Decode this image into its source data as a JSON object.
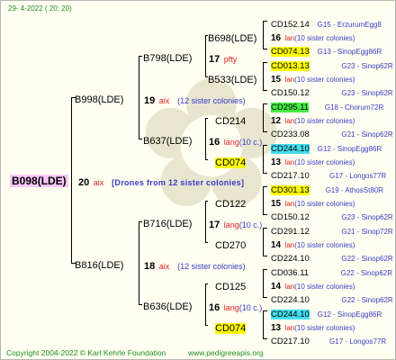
{
  "header": {
    "date": "29-  4-2022  ( 20:  20)"
  },
  "footer": {
    "copyright": "Copyright 2004-2022 © Karl Kehrle Foundation",
    "site": "www.pedigreeapis.org"
  },
  "root": {
    "label": "B098(LDE)",
    "count": "20",
    "aix": "aix",
    "note": "[Drones from 12 sister colonies]"
  },
  "gen1": [
    {
      "label": "B998(LDE)",
      "count": "19",
      "aix": "aix",
      "note": "(12 sister colonies)"
    },
    {
      "label": "B816(LDE)",
      "count": "18",
      "aix": "aix",
      "note": "(12 sister colonies)"
    }
  ],
  "gen2": [
    {
      "label": "B798(LDE)",
      "count": "17",
      "lang": "pfty",
      "paren": ""
    },
    {
      "label": "B637(LDE)",
      "count": "16",
      "lang": "lang",
      "paren": "(10 c.)"
    },
    {
      "label": "B716(LDE)",
      "count": "17",
      "lang": "lang",
      "paren": "(10 c.)"
    },
    {
      "label": "B636(LDE)",
      "count": "16",
      "lang": "lang",
      "paren": "(10 c.)"
    }
  ],
  "gen3": [
    {
      "label": "B698(LDE)",
      "count": "17",
      "lang": "pfty",
      "paren": ""
    },
    {
      "label": "B533(LDE)",
      "count": "",
      "lang": "",
      "paren": ""
    },
    {
      "label": "CD214",
      "count": "",
      "lang": "",
      "paren": ""
    },
    {
      "label": "CD074",
      "count": "",
      "lang": "",
      "paren": ""
    },
    {
      "label": "CD122",
      "count": "",
      "lang": "",
      "paren": ""
    },
    {
      "label": "CD270",
      "count": "",
      "lang": "",
      "paren": ""
    },
    {
      "label": "CD125",
      "count": "",
      "lang": "",
      "paren": ""
    },
    {
      "label": "CD074",
      "count": "",
      "lang": "",
      "paren": ""
    }
  ],
  "leaves": [
    {
      "kind": "id",
      "id": "CD152.14",
      "info": "G15 - ErzurumEgg8"
    },
    {
      "kind": "cnt",
      "num": "16",
      "lan": "lan",
      "rest": "(10 sister colonies)"
    },
    {
      "kind": "id",
      "id": "CD074.13",
      "info": "G13 - SinopEgg86R"
    },
    {
      "kind": "id",
      "id": "CD013.13",
      "info": "G23 - Sinop62R"
    },
    {
      "kind": "cnt",
      "num": "15",
      "lan": "lan",
      "rest": "(10 sister colonies)"
    },
    {
      "kind": "id",
      "id": "CD150.12",
      "info": "G23 - Sinop62R"
    },
    {
      "kind": "id",
      "id": "CD295.11",
      "info": "G18 - Chorum72R"
    },
    {
      "kind": "cnt",
      "num": "12",
      "lan": "lan",
      "rest": "(10 sister colonies)"
    },
    {
      "kind": "id",
      "id": "CD233.08",
      "info": "G21 - Sinop62R"
    },
    {
      "kind": "id",
      "id": "CD244.10",
      "info": "G12 - SinopEgg86R"
    },
    {
      "kind": "cnt",
      "num": "13",
      "lan": "lan",
      "rest": "(10 sister colonies)"
    },
    {
      "kind": "id",
      "id": "CD217.10",
      "info": "G17 - Longos77R"
    },
    {
      "kind": "id",
      "id": "CD301.13",
      "info": "G19 - AthosSt80R"
    },
    {
      "kind": "cnt",
      "num": "15",
      "lan": "lan",
      "rest": "(10 sister colonies)"
    },
    {
      "kind": "id",
      "id": "CD150.12",
      "info": "G23 - Sinop62R"
    },
    {
      "kind": "id",
      "id": "CD291.12",
      "info": "G21 - Sinop72R"
    },
    {
      "kind": "cnt",
      "num": "14",
      "lan": "lan",
      "rest": "(10 sister colonies)"
    },
    {
      "kind": "id",
      "id": "CD224.10",
      "info": "G22 - Sinop62R"
    },
    {
      "kind": "id",
      "id": "CD036.11",
      "info": "G22 - Sinop62R"
    },
    {
      "kind": "cnt",
      "num": "14",
      "lan": "lan",
      "rest": "(10 sister colonies)"
    },
    {
      "kind": "id",
      "id": "CD224.10",
      "info": "G22 - Sinop62R"
    },
    {
      "kind": "id",
      "id": "CD244.10",
      "info": "G12 - SinopEgg86R"
    },
    {
      "kind": "cnt",
      "num": "13",
      "lan": "lan",
      "rest": "(10 sister colonies)"
    },
    {
      "kind": "id",
      "id": "CD217.10",
      "info": "G17 - Longos77R"
    }
  ],
  "colors": {
    "background": "#fffff2",
    "green_text": "#208c20",
    "blue_text": "#3a3ac8",
    "red_text": "#e02020",
    "root_highlight": "#f8c8f8",
    "yellow_highlight": "#ffff00",
    "green_highlight": "#44ee44",
    "cyan_highlight": "#44ddee"
  }
}
